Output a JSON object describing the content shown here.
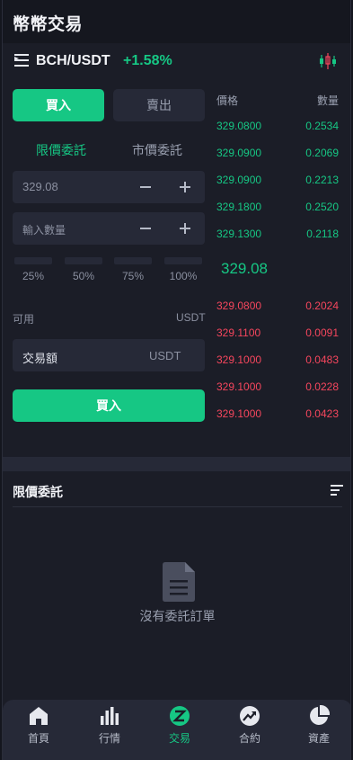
{
  "header": {
    "title": "幣幣交易"
  },
  "pair": {
    "name": "BCH/USDT",
    "change": "+1.58%"
  },
  "icons": {
    "menu": "list-menu-icon",
    "kline": "candlestick-chart-icon"
  },
  "trade": {
    "buy_tab": "買入",
    "sell_tab": "賣出",
    "limit_type": "限價委託",
    "market_type": "市價委託",
    "price_value": "329.08",
    "qty_placeholder": "輸入數量",
    "percents": [
      "25%",
      "50%",
      "75%",
      "100%"
    ],
    "available_label": "可用",
    "available_unit": "USDT",
    "amount_label": "交易額",
    "amount_unit": "USDT",
    "submit_label": "買入"
  },
  "orderbook": {
    "price_header": "價格",
    "qty_header": "數量",
    "bids": [
      {
        "price": "329.0800",
        "qty": "0.2534"
      },
      {
        "price": "329.0900",
        "qty": "0.2069"
      },
      {
        "price": "329.0900",
        "qty": "0.2213"
      },
      {
        "price": "329.1800",
        "qty": "0.2520"
      },
      {
        "price": "329.1300",
        "qty": "0.2118"
      }
    ],
    "last_price": "329.08",
    "asks": [
      {
        "price": "329.0800",
        "qty": "0.2024"
      },
      {
        "price": "329.1100",
        "qty": "0.0091"
      },
      {
        "price": "329.1000",
        "qty": "0.0483"
      },
      {
        "price": "329.1000",
        "qty": "0.0228"
      },
      {
        "price": "329.1000",
        "qty": "0.0423"
      }
    ]
  },
  "orders": {
    "title": "限價委託",
    "empty_text": "沒有委託訂單"
  },
  "tabs": [
    {
      "label": "首頁",
      "icon": "home-icon"
    },
    {
      "label": "行情",
      "icon": "market-bars-icon"
    },
    {
      "label": "交易",
      "icon": "trade-icon"
    },
    {
      "label": "合約",
      "icon": "contract-icon"
    },
    {
      "label": "資產",
      "icon": "assets-pie-icon"
    }
  ],
  "colors": {
    "accent": "#16c784",
    "sell": "#f6465d",
    "bg": "#1b1d27",
    "panel": "#262937"
  }
}
